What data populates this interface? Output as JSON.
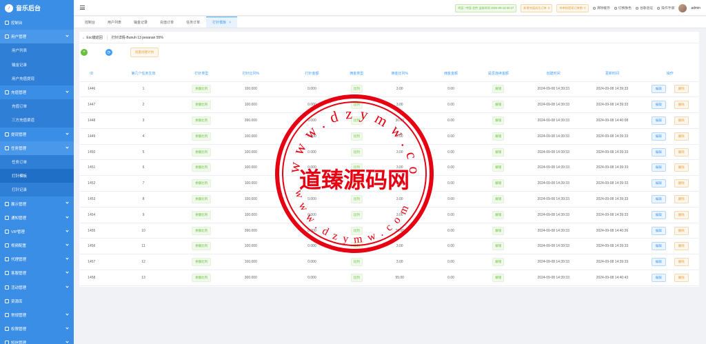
{
  "app": {
    "logo_initial": "♪",
    "title": "音乐后台"
  },
  "sidebar": {
    "items": [
      {
        "label": "控制台",
        "icon": "dashboard-icon",
        "type": "top"
      },
      {
        "label": "用户管理",
        "icon": "user-icon",
        "type": "group-open"
      },
      {
        "label": "用户列表",
        "type": "child"
      },
      {
        "label": "输金记录",
        "type": "child"
      },
      {
        "label": "用户充值提现",
        "type": "child"
      },
      {
        "label": "充值管理",
        "icon": "wallet-icon",
        "type": "group"
      },
      {
        "label": "充值订单",
        "type": "child"
      },
      {
        "label": "三方充值渠道",
        "type": "child"
      },
      {
        "label": "提现管理",
        "icon": "withdraw-icon",
        "type": "group"
      },
      {
        "label": "任务管理",
        "icon": "task-icon",
        "type": "group-open"
      },
      {
        "label": "任务订单",
        "type": "child"
      },
      {
        "label": "打针模板",
        "type": "child-active"
      },
      {
        "label": "打针记录",
        "type": "child"
      },
      {
        "label": "展示管理",
        "icon": "display-icon",
        "type": "group"
      },
      {
        "label": "通知管理",
        "icon": "bell-icon",
        "type": "group"
      },
      {
        "label": "VIP管理",
        "icon": "vip-icon",
        "type": "group"
      },
      {
        "label": "视频配置",
        "icon": "video-icon",
        "type": "group"
      },
      {
        "label": "代理管理",
        "icon": "agent-icon",
        "type": "group"
      },
      {
        "label": "客服管理",
        "icon": "service-icon",
        "type": "group"
      },
      {
        "label": "活动管理",
        "icon": "activity-icon",
        "type": "group"
      },
      {
        "label": "资源库",
        "icon": "resource-icon",
        "type": "top"
      },
      {
        "label": "常规管理",
        "icon": "settings-icon",
        "type": "group"
      },
      {
        "label": "权限管理",
        "icon": "permission-icon",
        "type": "group"
      },
      {
        "label": "短信管理",
        "icon": "sms-icon",
        "type": "group"
      }
    ]
  },
  "header": {
    "badges": [
      "时区: 中国 北京 当前时间 2025-08-18 00:27",
      "新增充值成功订单: 9",
      "待审核提现订单数: 0"
    ],
    "links": [
      "清除缓存",
      "切换肤色",
      "谷歌验证",
      "操作手册"
    ],
    "username": "admin"
  },
  "tabs": [
    {
      "label": "控制台"
    },
    {
      "label": "用户列表"
    },
    {
      "label": "输金记录"
    },
    {
      "label": "充值订单"
    },
    {
      "label": "任务订单"
    },
    {
      "label": "打针模板",
      "active": true,
      "close": "×"
    }
  ],
  "breadcrumb": {
    "back": "← Esc键返回",
    "title": "打针详情-Bunuh 13 pesanan 55%"
  },
  "toolbar": {
    "add_glyph": "+",
    "refresh_glyph": "⟳",
    "batch_label": "批量创建计划"
  },
  "table": {
    "headers": [
      "ID",
      "第几个任务生效",
      "打针类型",
      "打针比列%",
      "打针金额",
      "佣金类型",
      "佣金比列%",
      "佣金金额",
      "是否连续金额",
      "创建时间",
      "更新时间",
      "操作"
    ],
    "edit_label": "编辑",
    "delete_label": "删除",
    "rows": [
      {
        "id": "1446",
        "n": "1",
        "type": "余额比列",
        "ratio": "100.000",
        "amount": "0.000",
        "ctype": "比列",
        "cratio": "3.00",
        "camount": "0.00",
        "cont": "解锁",
        "created": "2024-09-08 14:39:33",
        "updated": "2024-09-08 14:39:33"
      },
      {
        "id": "1447",
        "n": "2",
        "type": "余额比列",
        "ratio": "100.000",
        "amount": "0.000",
        "ctype": "比列",
        "cratio": "3.00",
        "camount": "0.00",
        "cont": "解锁",
        "created": "2024-09-08 14:39:33",
        "updated": "2024-09-08 14:39:33"
      },
      {
        "id": "1448",
        "n": "3",
        "type": "余额比列",
        "ratio": "390.000",
        "amount": "0.000",
        "ctype": "比列",
        "cratio": "30.00",
        "camount": "0.00",
        "cont": "解锁",
        "created": "2024-09-08 14:39:33",
        "updated": "2024-09-08 14:40:08"
      },
      {
        "id": "1449",
        "n": "4",
        "type": "余额比列",
        "ratio": "100.000",
        "amount": "0.000",
        "ctype": "比列",
        "cratio": "3.00",
        "camount": "0.00",
        "cont": "解锁",
        "created": "2024-09-08 14:39:33",
        "updated": "2024-09-08 14:39:33"
      },
      {
        "id": "1450",
        "n": "5",
        "type": "余额比列",
        "ratio": "100.000",
        "amount": "0.000",
        "ctype": "比列",
        "cratio": "3.00",
        "camount": "0.00",
        "cont": "解锁",
        "created": "2024-09-08 14:39:33",
        "updated": "2024-09-08 14:39:33"
      },
      {
        "id": "1451",
        "n": "6",
        "type": "余额比列",
        "ratio": "100.000",
        "amount": "0.000",
        "ctype": "比列",
        "cratio": "3.00",
        "camount": "0.00",
        "cont": "解锁",
        "created": "2024-09-08 14:39:33",
        "updated": "2024-09-08 14:39:33"
      },
      {
        "id": "1452",
        "n": "7",
        "type": "余额比列",
        "ratio": "100.000",
        "amount": "0.000",
        "ctype": "比列",
        "cratio": "3.00",
        "camount": "0.00",
        "cont": "解锁",
        "created": "2024-09-08 14:39:33",
        "updated": "2024-09-08 14:39:33"
      },
      {
        "id": "1453",
        "n": "8",
        "type": "余额比列",
        "ratio": "100.000",
        "amount": "0.000",
        "ctype": "比列",
        "cratio": "3.00",
        "camount": "0.00",
        "cont": "解锁",
        "created": "2024-09-08 14:39:33",
        "updated": "2024-09-08 14:39:33"
      },
      {
        "id": "1454",
        "n": "9",
        "type": "余额比列",
        "ratio": "100.000",
        "amount": "0.000",
        "ctype": "比列",
        "cratio": "3.00",
        "camount": "0.00",
        "cont": "解锁",
        "created": "2024-09-08 14:39:33",
        "updated": "2024-09-08 14:39:33"
      },
      {
        "id": "1455",
        "n": "10",
        "type": "余额比列",
        "ratio": "390.000",
        "amount": "0.000",
        "ctype": "比列",
        "cratio": "30.00",
        "camount": "0.00",
        "cont": "解锁",
        "created": "2024-09-08 14:39:33",
        "updated": "2024-09-08 14:40:26"
      },
      {
        "id": "1456",
        "n": "11",
        "type": "余额比列",
        "ratio": "100.000",
        "amount": "0.000",
        "ctype": "比列",
        "cratio": "3.00",
        "camount": "0.00",
        "cont": "解锁",
        "created": "2024-09-08 14:39:33",
        "updated": "2024-09-08 14:39:33"
      },
      {
        "id": "1457",
        "n": "12",
        "type": "余额比列",
        "ratio": "100.000",
        "amount": "0.000",
        "ctype": "比列",
        "cratio": "3.00",
        "camount": "0.00",
        "cont": "解锁",
        "created": "2024-09-08 14:39:33",
        "updated": "2024-09-08 14:39:33"
      },
      {
        "id": "1458",
        "n": "13",
        "type": "余额比列",
        "ratio": "300.000",
        "amount": "0.000",
        "ctype": "比列",
        "cratio": "55.00",
        "camount": "0.00",
        "cont": "解锁",
        "created": "2024-09-08 14:39:33",
        "updated": "2024-09-08 14:40:43"
      }
    ]
  },
  "watermark": {
    "text": "道臻源码网",
    "url_top": "www.dzymw.com",
    "url_bottom": "www.dzymw.com",
    "color": "#e60012"
  }
}
